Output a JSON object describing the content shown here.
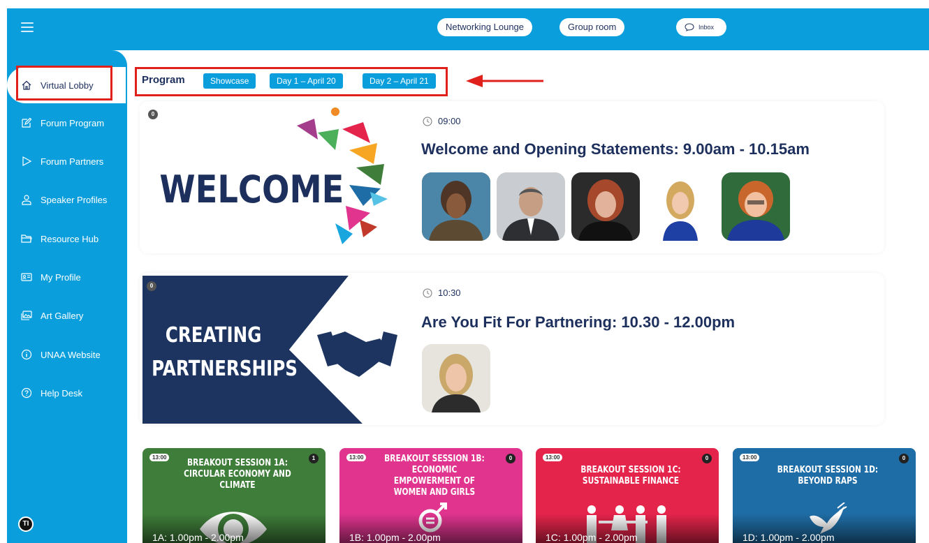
{
  "topbar": {
    "networking_label": "Networking Lounge",
    "group_label": "Group room",
    "inbox_label": "Inbox"
  },
  "sidebar": {
    "items": [
      {
        "label": "Virtual Lobby",
        "icon": "home-icon"
      },
      {
        "label": "Forum Program",
        "icon": "edit-icon"
      },
      {
        "label": "Forum Partners",
        "icon": "play-icon"
      },
      {
        "label": "Speaker Profiles",
        "icon": "user-icon"
      },
      {
        "label": "Resource Hub",
        "icon": "folder-icon"
      },
      {
        "label": "My Profile",
        "icon": "id-card-icon"
      },
      {
        "label": "Art Gallery",
        "icon": "gallery-icon"
      },
      {
        "label": "UNAA Website",
        "icon": "info-icon"
      },
      {
        "label": "Help Desk",
        "icon": "help-icon"
      }
    ],
    "logo_text": "TI"
  },
  "program": {
    "title": "Program",
    "tabs": [
      "Showcase",
      "Day 1 – April 20",
      "Day 2 – April 21"
    ]
  },
  "sessions": [
    {
      "badge": "0",
      "time": "09:00",
      "title": "Welcome and Opening Statements: 9.00am - 10.15am",
      "image_text": "WELCOME"
    },
    {
      "badge": "0",
      "time": "10:30",
      "title": "Are You Fit For Partnering: 10.30 - 12.00pm",
      "image_text_line1": "CREATING",
      "image_text_line2": "PARTNERSHIPS"
    }
  ],
  "breakouts": [
    {
      "time": "13:00",
      "count": "1",
      "title": "BREAKOUT SESSION 1A: CIRCULAR ECONOMY AND CLIMATE",
      "footer": "1A: 1.00pm - 2.00pm",
      "color": "#3f7e3a"
    },
    {
      "time": "13:00",
      "count": "0",
      "title": "BREAKOUT SESSION 1B: ECONOMIC EMPOWERMENT OF WOMEN AND GIRLS",
      "footer": "1B: 1.00pm - 2.00pm",
      "color": "#e0348f"
    },
    {
      "time": "13:00",
      "count": "0",
      "title": "BREAKOUT SESSION 1C: SUSTAINABLE FINANCE",
      "footer": "1C: 1.00pm - 2.00pm",
      "color": "#e5244b"
    },
    {
      "time": "13:00",
      "count": "0",
      "title": "BREAKOUT SESSION 1D: BEYOND RAPS",
      "footer": "1D: 1.00pm - 2.00pm",
      "color": "#1f6da6"
    }
  ],
  "colors": {
    "brand_blue": "#0a9fdc",
    "navy": "#1d2f5c",
    "highlight_red": "#e0201b"
  }
}
